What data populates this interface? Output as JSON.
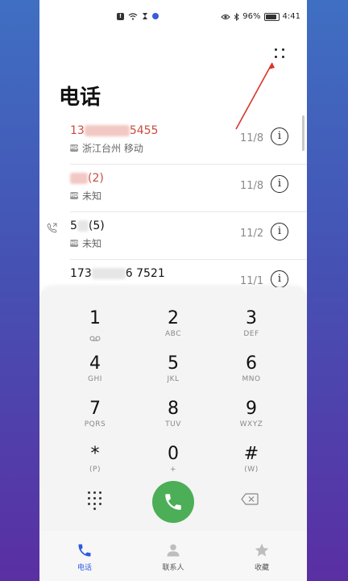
{
  "status_bar": {
    "battery": "96%",
    "time": "4:41"
  },
  "page": {
    "title": "电话"
  },
  "calls": [
    {
      "name_visible_end": "5455",
      "name_prefix": "13",
      "location": "浙江台州 移动",
      "date": "11/8",
      "missed": true
    },
    {
      "name_visible_end": "(2)",
      "name_prefix": "",
      "location": "未知",
      "date": "11/8",
      "missed": true
    },
    {
      "name_visible_end": "(5)",
      "name_prefix": "5",
      "location": "未知",
      "date": "11/2",
      "missed": false
    },
    {
      "name_visible_end": "6 7521",
      "name_prefix": "173",
      "location": "",
      "date": "11/1",
      "missed": false
    }
  ],
  "dialpad": {
    "keys": [
      {
        "digit": "1",
        "letters": ""
      },
      {
        "digit": "2",
        "letters": "ABC"
      },
      {
        "digit": "3",
        "letters": "DEF"
      },
      {
        "digit": "4",
        "letters": "GHI"
      },
      {
        "digit": "5",
        "letters": "JKL"
      },
      {
        "digit": "6",
        "letters": "MNO"
      },
      {
        "digit": "7",
        "letters": "PQRS"
      },
      {
        "digit": "8",
        "letters": "TUV"
      },
      {
        "digit": "9",
        "letters": "WXYZ"
      },
      {
        "digit": "*",
        "letters": "(P)"
      },
      {
        "digit": "0",
        "letters": "+"
      },
      {
        "digit": "#",
        "letters": "(W)"
      }
    ]
  },
  "bottom_nav": {
    "phone": "电话",
    "contacts": "联系人",
    "favorites": "收藏"
  },
  "colors": {
    "missed": "#c84b3e",
    "call_button": "#4cae56",
    "active_nav": "#2d5be3",
    "annotation_arrow": "#d9342b"
  }
}
